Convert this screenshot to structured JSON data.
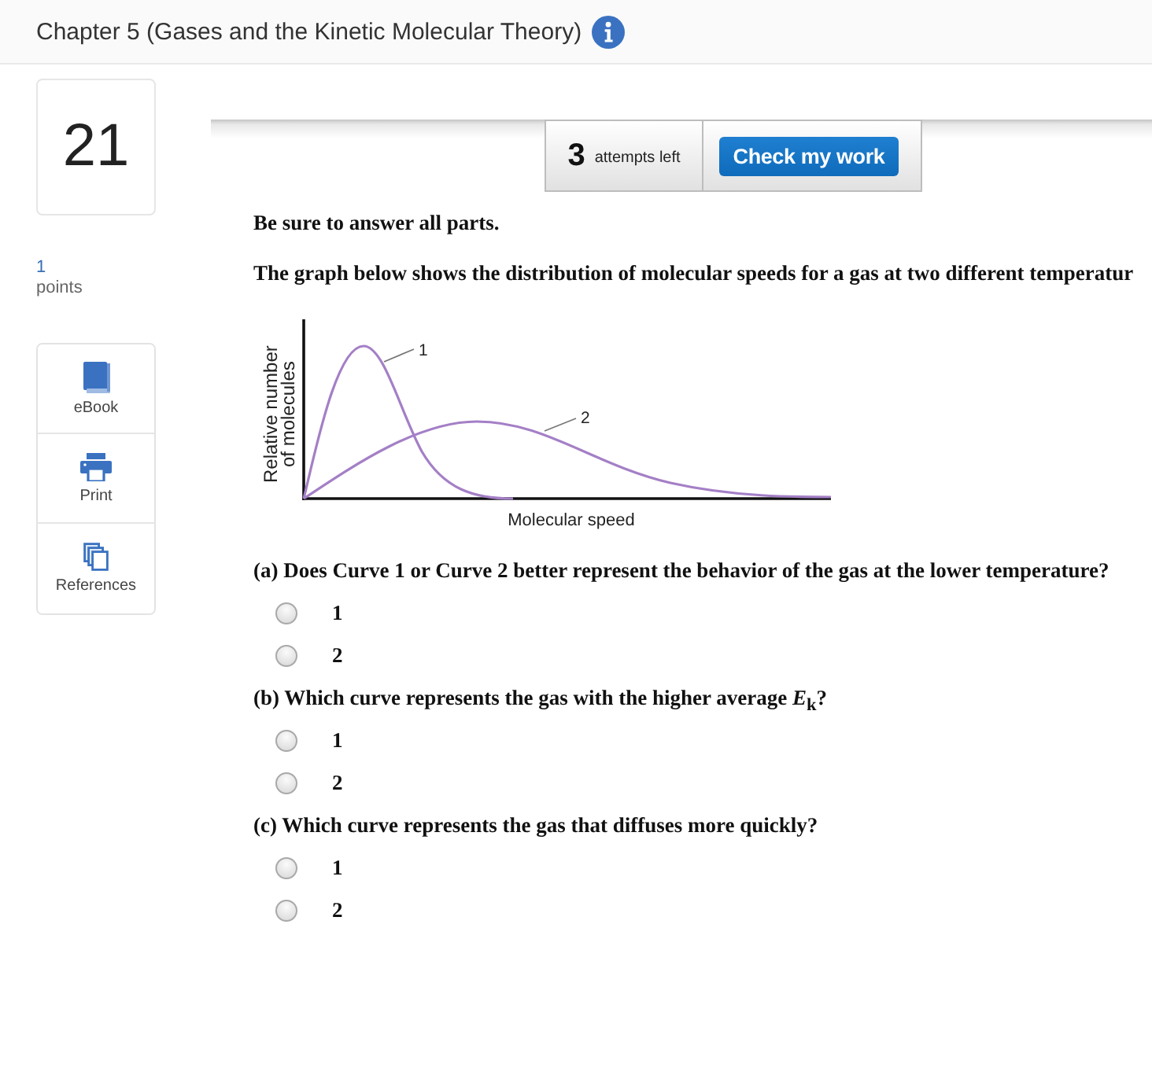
{
  "header": {
    "title": "Chapter 5 (Gases and the Kinetic Molecular Theory)"
  },
  "question_number": "21",
  "points": {
    "value": "1",
    "label": "points"
  },
  "tools": [
    {
      "kind": "ebook",
      "label": "eBook"
    },
    {
      "kind": "print",
      "label": "Print"
    },
    {
      "kind": "references",
      "label": "References"
    }
  ],
  "attempts": {
    "count": "3",
    "label": "attempts left"
  },
  "check_button": {
    "label": "Check my work"
  },
  "instructions": "Be sure to answer all parts.",
  "prompt": "The graph below shows the distribution of molecular speeds for a gas at two different temperatur",
  "graph": {
    "ylabel": "Relative number of molecules",
    "xlabel": "Molecular speed",
    "curves": [
      {
        "kind": "narrow",
        "label": "1"
      },
      {
        "kind": "broad",
        "label": "2"
      }
    ]
  },
  "questions": [
    {
      "text": "(a) Does Curve 1 or Curve 2 better represent the behavior of the gas at the lower temperature?",
      "options": [
        {
          "label": "1",
          "selected": false
        },
        {
          "label": "2",
          "selected": false
        }
      ]
    },
    {
      "text": "(b) Which curve represents the gas with the higher average *E*$_{k}$?",
      "options": [
        {
          "label": "1",
          "selected": false
        },
        {
          "label": "2",
          "selected": false
        }
      ]
    },
    {
      "text": "(c) Which curve represents the gas that diffuses more quickly?",
      "options": [
        {
          "label": "1",
          "selected": false
        },
        {
          "label": "2",
          "selected": false
        }
      ]
    }
  ]
}
